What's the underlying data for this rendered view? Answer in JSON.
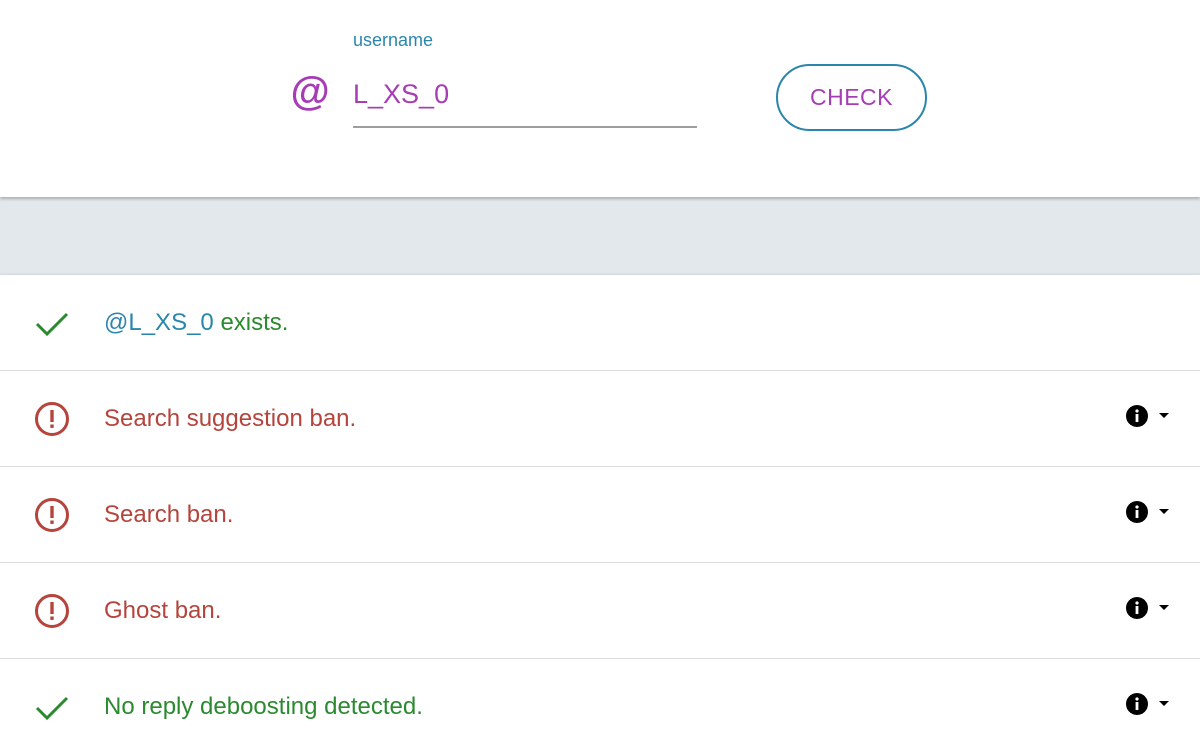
{
  "search": {
    "at_symbol": "@",
    "label": "username",
    "value": "L_XS_0",
    "button_label": "CHECK"
  },
  "results": [
    {
      "status": "ok",
      "handle": "@L_XS_0",
      "text": " exists.",
      "has_info": false
    },
    {
      "status": "error",
      "text": "Search suggestion ban.",
      "has_info": true
    },
    {
      "status": "error",
      "text": "Search ban.",
      "has_info": true
    },
    {
      "status": "error",
      "text": "Ghost ban.",
      "has_info": true
    },
    {
      "status": "ok",
      "text": "No reply deboosting detected.",
      "has_info": true
    }
  ],
  "colors": {
    "accent_purple": "#a63db5",
    "accent_blue": "#2a86ad",
    "ok_green": "#2b8a2f",
    "error_red": "#b5443c",
    "band_grey": "#e3e8ec"
  },
  "icons": {
    "ok": "check-icon",
    "error": "alert-circle-icon",
    "info": "info-icon",
    "dropdown": "caret-down-icon"
  }
}
